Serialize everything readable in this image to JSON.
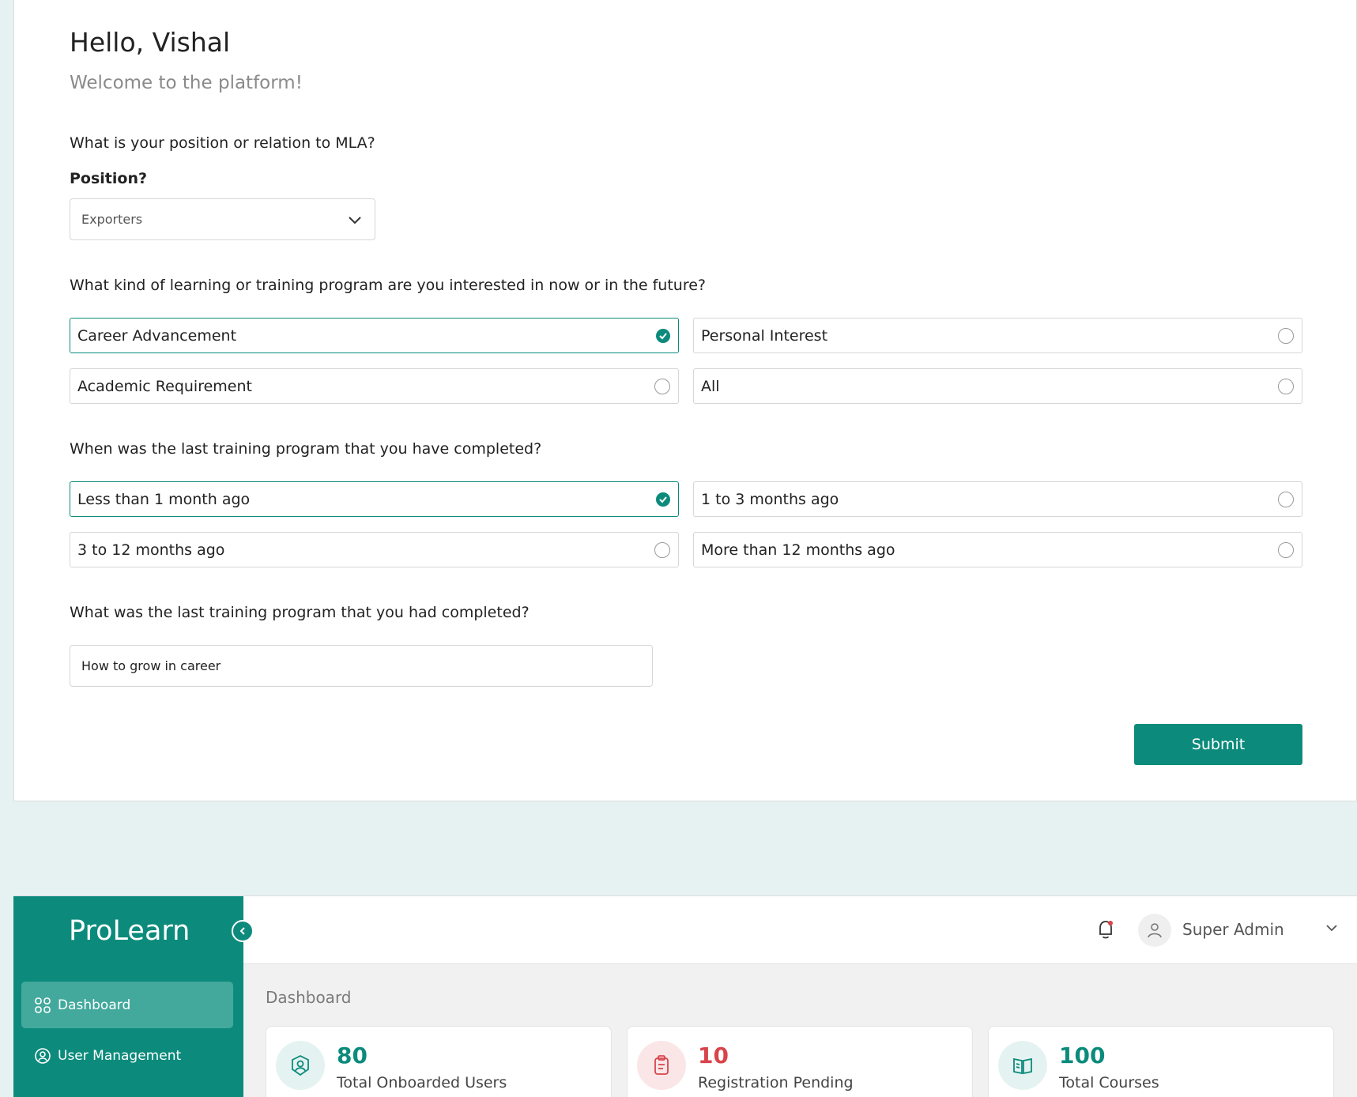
{
  "greeting": "Hello, Vishal",
  "welcome": "Welcome to the platform!",
  "q1": {
    "question": "What is your position or relation to MLA?",
    "field_label": "Position?",
    "selected_value": "Exporters"
  },
  "q2": {
    "question": "What kind of learning or training program are you interested in now or in the future?",
    "options": [
      {
        "label": "Career Advancement",
        "selected": true
      },
      {
        "label": "Personal Interest",
        "selected": false
      },
      {
        "label": "Academic Requirement",
        "selected": false
      },
      {
        "label": "All",
        "selected": false
      }
    ]
  },
  "q3": {
    "question": "When was the last training program that you have completed?",
    "options": [
      {
        "label": "Less than 1 month ago",
        "selected": true
      },
      {
        "label": "1 to 3 months ago",
        "selected": false
      },
      {
        "label": "3 to 12 months ago",
        "selected": false
      },
      {
        "label": "More than 12 months ago",
        "selected": false
      }
    ]
  },
  "q4": {
    "question": "What was the last training program that you had completed?",
    "value": "How to grow in career"
  },
  "submit_label": "Submit",
  "dashboard": {
    "brand": "ProLearn",
    "nav": [
      {
        "label": "Dashboard",
        "icon": "grid-icon",
        "active": true
      },
      {
        "label": "User Management",
        "icon": "user-badge-icon",
        "active": false
      }
    ],
    "user_name": "Super Admin",
    "breadcrumb": "Dashboard",
    "stats": [
      {
        "value": "80",
        "label": "Total Onboarded Users",
        "color": "#0c8b7c",
        "icon": "user-badge-icon"
      },
      {
        "value": "10",
        "label": "Registration Pending",
        "color": "#d9444c",
        "icon": "clipboard-icon"
      },
      {
        "value": "100",
        "label": "Total Courses",
        "color": "#0c8b7c",
        "icon": "book-icon"
      }
    ]
  },
  "colors": {
    "accent": "#0c8b7c",
    "danger": "#d9444c",
    "background": "#e6f2f1"
  }
}
